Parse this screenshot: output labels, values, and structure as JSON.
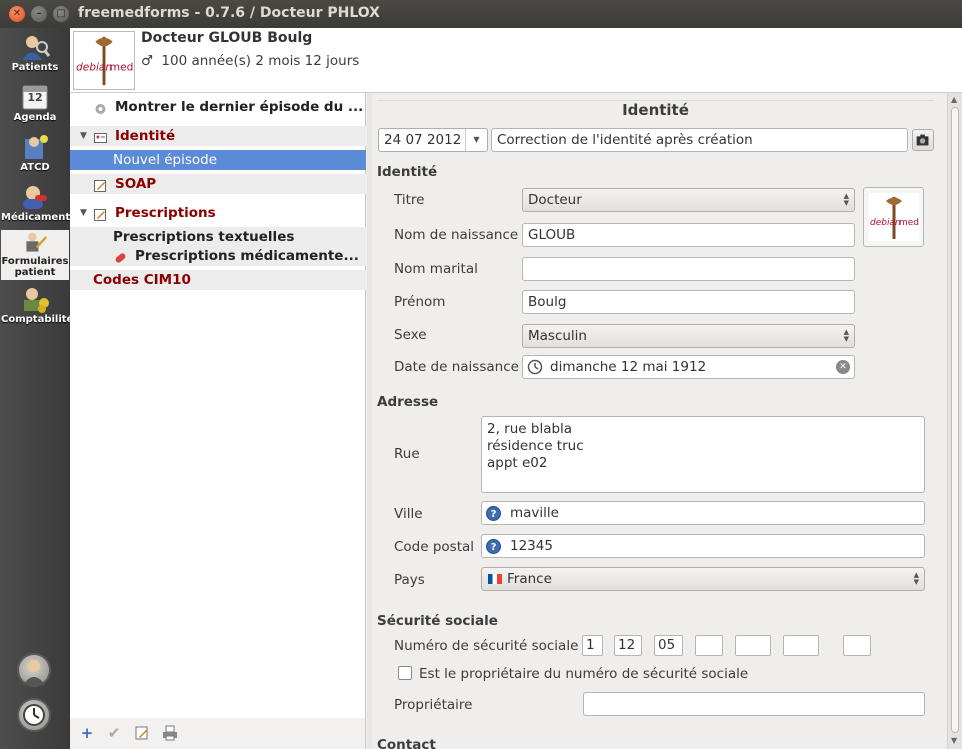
{
  "window": {
    "title": "freemedforms - 0.7.6 / Docteur PHLOX"
  },
  "leftbar": {
    "items": [
      {
        "label": "Patients"
      },
      {
        "label": "Agenda",
        "badge": "12"
      },
      {
        "label": "ATCD"
      },
      {
        "label": "Médicaments"
      },
      {
        "label_line1": "Formulaires",
        "label_line2": "patient"
      },
      {
        "label": "Comptabilité"
      }
    ]
  },
  "header": {
    "logo_text": "debian med",
    "patient_name": "Docteur GLOUB Boulg",
    "gender_symbol": "♂",
    "age": "100 année(s) 2 mois 12 jours"
  },
  "tree": {
    "items": [
      {
        "label": "Montrer le dernier épisode du ..."
      },
      {
        "label": "Identité"
      },
      {
        "label": "Nouvel épisode"
      },
      {
        "label": "SOAP"
      },
      {
        "label": "Prescriptions"
      },
      {
        "label": "Prescriptions textuelles"
      },
      {
        "label": "Prescriptions médicamente..."
      },
      {
        "label": "Codes CIM10"
      }
    ]
  },
  "form": {
    "title": "Identité",
    "episode_date": "24 07 2012",
    "episode_label": "Correction de l'identité après création",
    "identity_group": "Identité",
    "titre_label": "Titre",
    "titre_value": "Docteur",
    "nom_naissance_label": "Nom de naissance",
    "nom_naissance_value": "GLOUB",
    "nom_marital_label": "Nom marital",
    "nom_marital_value": "",
    "prenom_label": "Prénom",
    "prenom_value": "Boulg",
    "sexe_label": "Sexe",
    "sexe_value": "Masculin",
    "date_naissance_label": "Date de naissance",
    "date_naissance_value": "dimanche 12 mai 1912",
    "address_group": "Adresse",
    "rue_label": "Rue",
    "rue_line1": "2, rue blabla",
    "rue_line2": "résidence truc",
    "rue_line3": "appt e02",
    "ville_label": "Ville",
    "ville_value": "maville",
    "cp_label": "Code postal",
    "cp_value": "12345",
    "pays_label": "Pays",
    "pays_value": "France",
    "secu_group": "Sécurité sociale",
    "nss_label": "Numéro de sécurité sociale",
    "nss_parts": [
      "1",
      "12",
      "05",
      "",
      "",
      "",
      ""
    ],
    "owner_check_label": "Est le propriétaire du numéro de sécurité sociale",
    "proprietaire_label": "Propriétaire",
    "proprietaire_value": "",
    "contact_group": "Contact"
  },
  "colors": {
    "accent_red": "#8b0000",
    "selection": "#5b8bd6",
    "titlebar": "#3c3b37"
  }
}
